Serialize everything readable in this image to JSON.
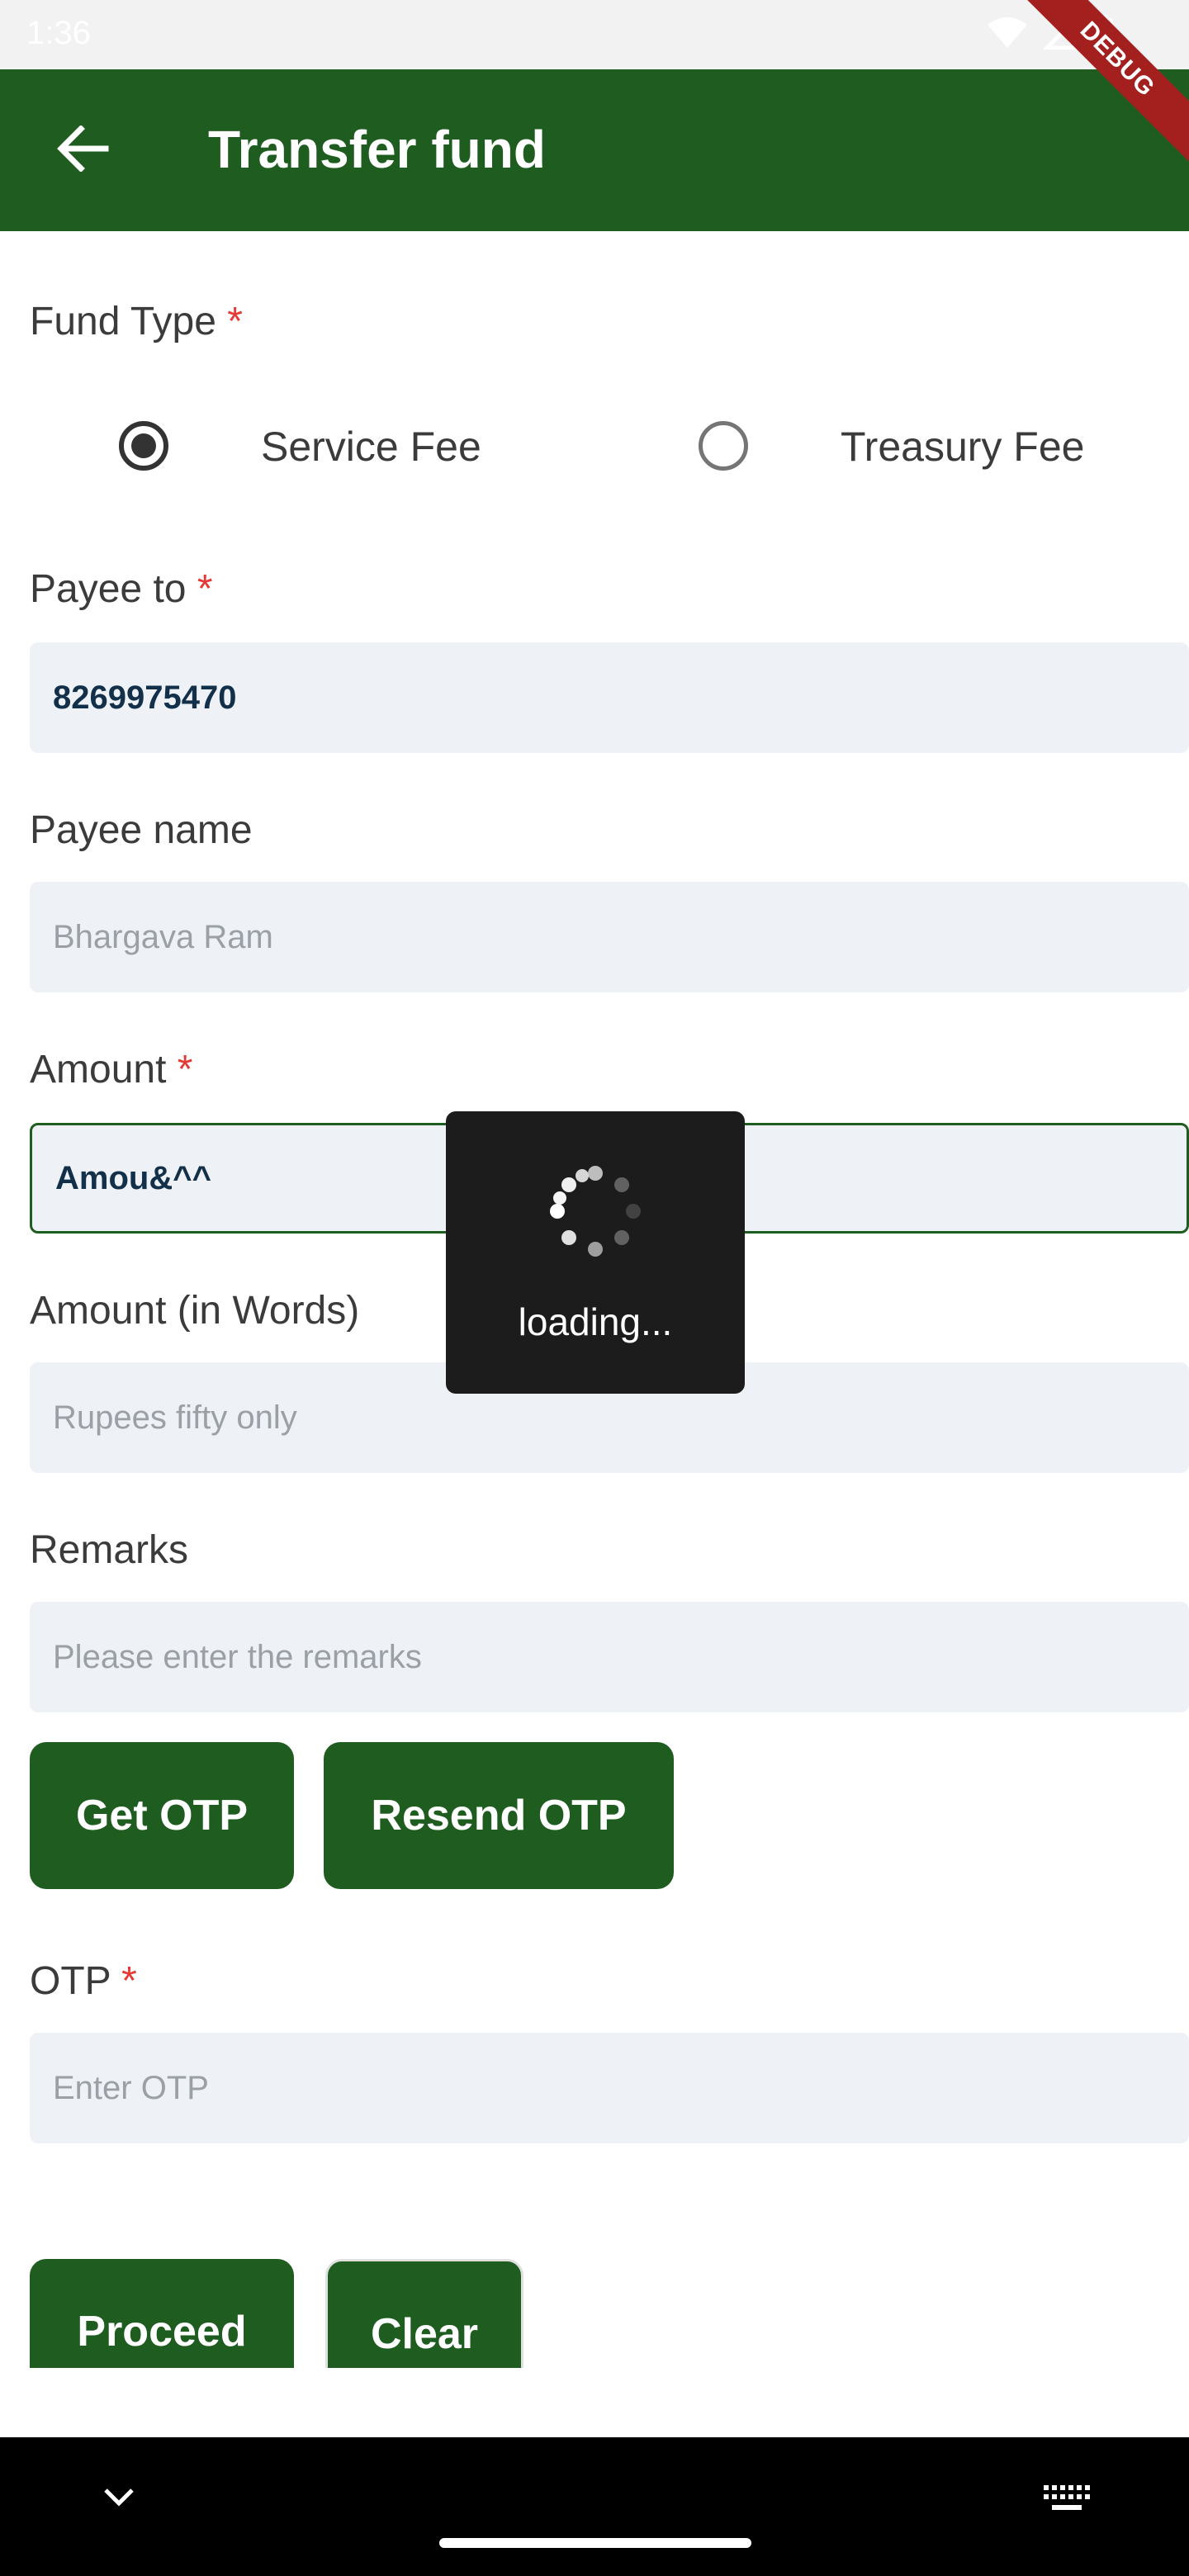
{
  "status_bar": {
    "time": "1:36",
    "debug_label": "DEBUG"
  },
  "app_bar": {
    "title": "Transfer fund",
    "back_icon": "arrow-left-icon"
  },
  "fund_type": {
    "label": "Fund Type",
    "required_mark": "*",
    "options": [
      {
        "label": "Service Fee",
        "selected": true
      },
      {
        "label": "Treasury Fee",
        "selected": false
      }
    ]
  },
  "payee_to": {
    "label": "Payee to",
    "required_mark": "*",
    "value": "8269975470"
  },
  "payee_name": {
    "label": "Payee name",
    "placeholder": "Bhargava Ram"
  },
  "amount": {
    "label": "Amount",
    "required_mark": "*",
    "value": "Amou&^^"
  },
  "amount_words": {
    "label": "Amount (in Words)",
    "placeholder": "Rupees fifty only"
  },
  "remarks": {
    "label": "Remarks",
    "placeholder": "Please enter the remarks"
  },
  "otp_buttons": {
    "get": "Get OTP",
    "resend": "Resend OTP"
  },
  "otp": {
    "label": "OTP",
    "required_mark": "*",
    "placeholder": "Enter OTP"
  },
  "actions": {
    "proceed": "Proceed",
    "clear": "Clear"
  },
  "loading": {
    "text": "loading..."
  },
  "colors": {
    "primary": "#1e5c20",
    "field_bg": "#eef2f7",
    "required": "#e53935"
  }
}
